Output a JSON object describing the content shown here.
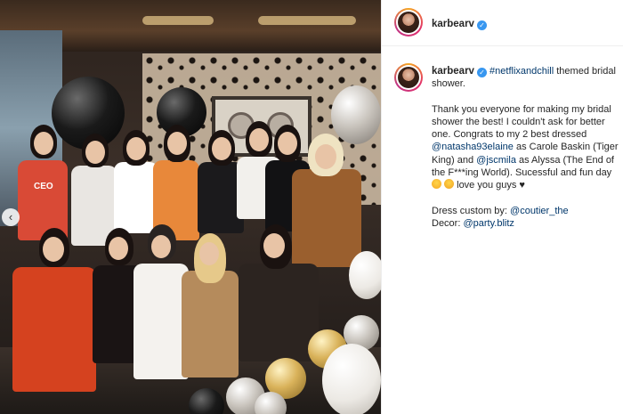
{
  "post": {
    "author": "karbearv",
    "verified_icon": "verified-badge-icon",
    "accent_color": "#3897f0",
    "link_color": "#00376b"
  },
  "caption": {
    "author": "karbearv",
    "hashtag": "#netflixandchill",
    "line1_rest": " themed bridal shower.",
    "para2_part1": "Thank you everyone for making my bridal shower the best! I couldn't ask for better one. Congrats to my 2 best dressed ",
    "mention1": "@natasha93elaine",
    "para2_part2": " as Carole Baskin (Tiger King) and ",
    "mention2": "@jscmila",
    "para2_part3": " as Alyssa (The End of the F***ing World). Sucessful and fun day ",
    "para2_part4": " love you guys ♥",
    "emoji1": "smiling-face-with-hearts",
    "emoji2": "pleading-face",
    "dress_label": "Dress custom by: ",
    "dress_mention": "@coutier_the",
    "decor_label": "Decor: ",
    "decor_mention": "@party.blitz"
  },
  "photo": {
    "name": "bridal-shower-group-photo",
    "shirt_text": "CEO"
  }
}
